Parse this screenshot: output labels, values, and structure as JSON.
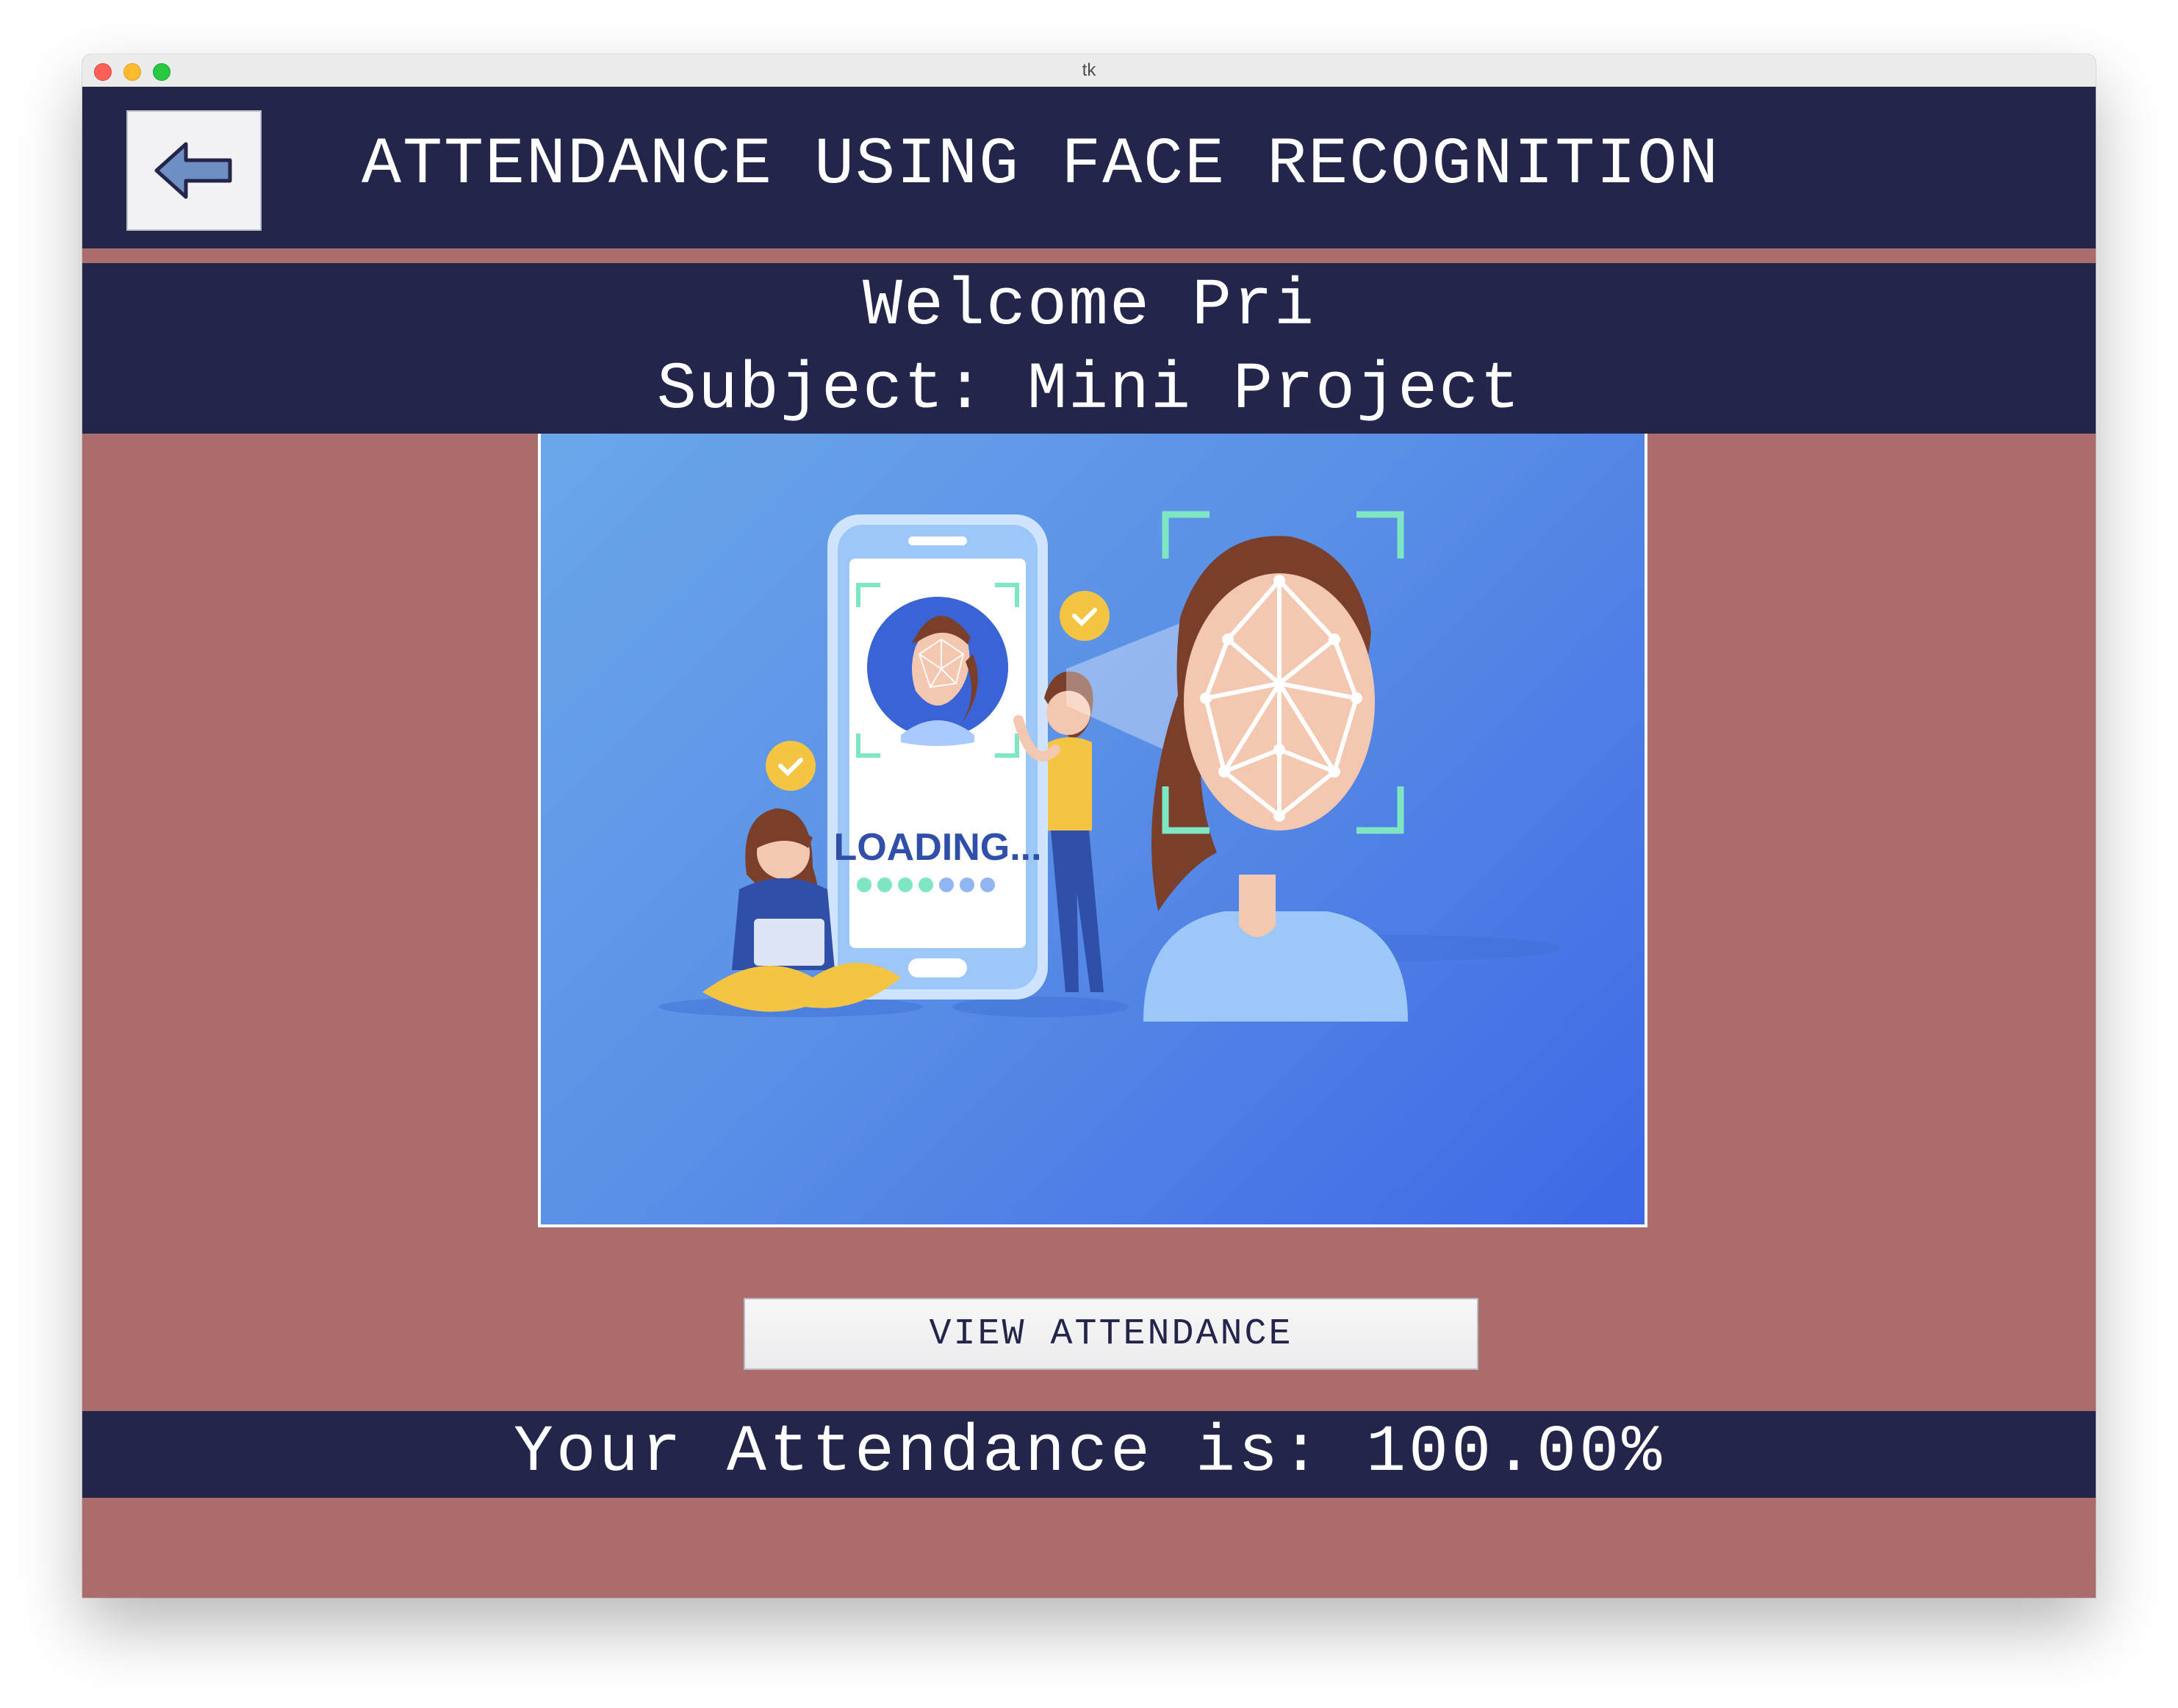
{
  "window": {
    "title": "tk"
  },
  "header": {
    "back_icon": "arrow-left-icon",
    "title": "ATTENDANCE USING FACE RECOGNITION"
  },
  "welcome": {
    "greeting": "Welcome Pri",
    "subject": "Subject: Mini Project"
  },
  "illustration": {
    "loading_text": "LOADING..."
  },
  "actions": {
    "view_attendance_label": "VIEW ATTENDANCE"
  },
  "attendance": {
    "summary": "Your Attendance is: 100.00%"
  },
  "colors": {
    "navy": "#23264a",
    "rose": "#ab6d6b",
    "illustration_blue": "#5a90e6",
    "accent_mint": "#7ee6c3",
    "badge_yellow": "#f6c443"
  }
}
